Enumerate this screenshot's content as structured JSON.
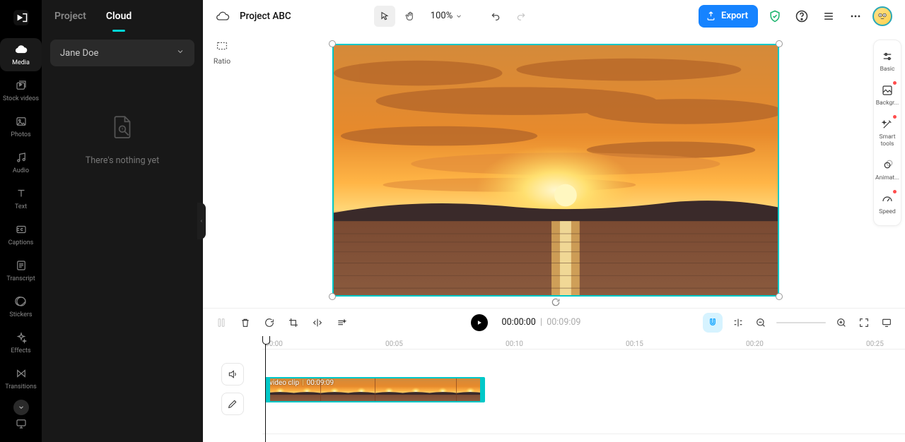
{
  "nav": {
    "items": [
      {
        "label": "Media"
      },
      {
        "label": "Stock videos"
      },
      {
        "label": "Photos"
      },
      {
        "label": "Audio"
      },
      {
        "label": "Text"
      },
      {
        "label": "Captions"
      },
      {
        "label": "Transcript"
      },
      {
        "label": "Stickers"
      },
      {
        "label": "Effects"
      },
      {
        "label": "Transitions"
      }
    ]
  },
  "media_panel": {
    "tabs": {
      "project": "Project",
      "cloud": "Cloud"
    },
    "user": "Jane Doe",
    "empty_text": "There's nothing yet"
  },
  "topbar": {
    "project_name": "Project ABC",
    "zoom": "100%",
    "export": "Export"
  },
  "stage": {
    "ratio_label": "Ratio"
  },
  "prop_rail": {
    "items": [
      {
        "label": "Basic",
        "dot": false
      },
      {
        "label": "Backgr...",
        "dot": true
      },
      {
        "label": "Smart tools",
        "dot": true
      },
      {
        "label": "Animat...",
        "dot": false
      },
      {
        "label": "Speed",
        "dot": true
      }
    ]
  },
  "timeline": {
    "current": "00:00:00",
    "duration": "00:09:09",
    "ruler": [
      "00:00",
      "00:05",
      "00:10",
      "00:15",
      "00:20",
      "00:25"
    ],
    "clip": {
      "name": "video clip",
      "len": "00:09:09"
    }
  }
}
